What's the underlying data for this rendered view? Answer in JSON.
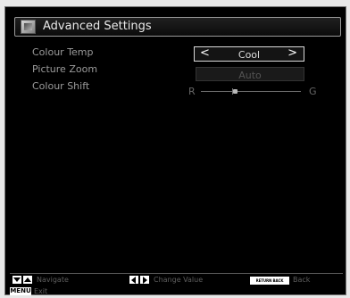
{
  "menu": {
    "title": "Advanced Settings",
    "rows": [
      {
        "label": "Colour Temp",
        "value": "Cool"
      },
      {
        "label": "Picture Zoom",
        "value": "Auto"
      },
      {
        "label": "Colour Shift",
        "left_label": "R",
        "right_label": "G",
        "level": 0.31
      }
    ]
  },
  "footer": {
    "navigate": "Navigate",
    "change_value": "Change Value",
    "back_key": "RETURN BACK",
    "back": "Back",
    "menu_key": "MENU",
    "exit": "Exit"
  }
}
